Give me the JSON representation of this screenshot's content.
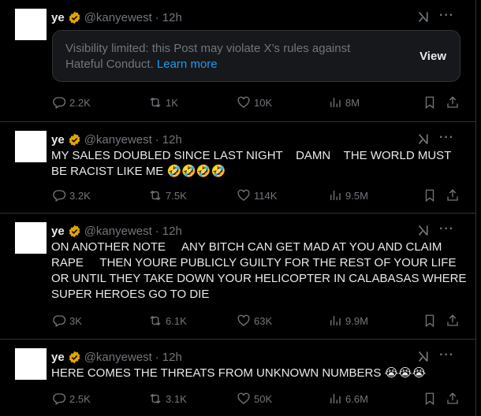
{
  "posts": [
    {
      "name": "ye",
      "handle": "@kanyewest",
      "dot": "·",
      "time": "12h",
      "notice": {
        "text": "Visibility limited: this Post may violate X’s rules against Hateful Conduct.",
        "link": "Learn more",
        "button": "View"
      },
      "text": "",
      "emoji": "",
      "replies": "2.2K",
      "reposts": "1K",
      "likes": "10K",
      "views": "8M"
    },
    {
      "name": "ye",
      "handle": "@kanyewest",
      "dot": "·",
      "time": "12h",
      "text": "MY SALES DOUBLED SINCE LAST NIGHT    DAMN    THE WORLD MUST BE RACIST LIKE ME ",
      "emoji": "🤣🤣🤣🤣",
      "replies": "3.2K",
      "reposts": "7.5K",
      "likes": "114K",
      "views": "9.5M"
    },
    {
      "name": "ye",
      "handle": "@kanyewest",
      "dot": "·",
      "time": "12h",
      "text": "ON ANOTHER NOTE     ANY BITCH CAN GET MAD AT YOU AND CLAIM RAPE     THEN YOURE PUBLICLY GUILTY FOR THE REST OF YOUR LIFE OR UNTIL THEY TAKE DOWN YOUR HELICOPTER IN CALABASAS WHERE SUPER HEROES GO TO DIE",
      "emoji": "",
      "replies": "3K",
      "reposts": "6.1K",
      "likes": "63K",
      "views": "9.9M"
    },
    {
      "name": "ye",
      "handle": "@kanyewest",
      "dot": "·",
      "time": "12h",
      "text": "HERE COMES THE THREATS FROM UNKNOWN NUMBERS ",
      "emoji": "😭😭😭",
      "replies": "2.5K",
      "reposts": "3.1K",
      "likes": "50K",
      "views": "6.6M"
    }
  ],
  "icons": {
    "verified": "verified-badge-icon",
    "grok": "grok-icon",
    "more": "more-icon",
    "reply": "reply-icon",
    "repost": "repost-icon",
    "like": "like-icon",
    "views": "views-icon",
    "bookmark": "bookmark-icon",
    "share": "share-icon"
  },
  "more_glyph": "···",
  "colors": {
    "background": "#000000",
    "text": "#e7e9ea",
    "muted": "#71767b",
    "link": "#1d9bf0",
    "badge": "#f4b400",
    "border": "#2f3336"
  }
}
